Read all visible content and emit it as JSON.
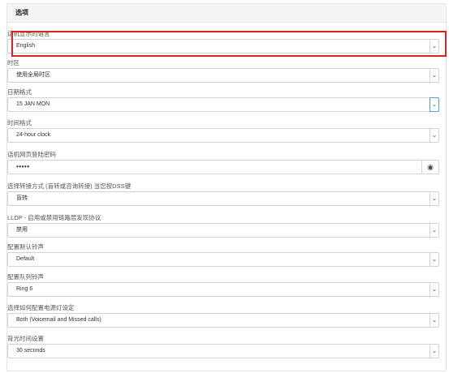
{
  "panel": {
    "title": "选项"
  },
  "fields": [
    {
      "label": "话机显示的语言",
      "value": "English",
      "control": "select"
    },
    {
      "label": "时区",
      "value": "使用全局时区",
      "control": "select"
    },
    {
      "label": "日期格式",
      "value": "15 JAN MON",
      "control": "select"
    },
    {
      "label": "时间格式",
      "value": "24-hour clock",
      "control": "select"
    },
    {
      "label": "话机网页登陆密码",
      "value": "•••••",
      "control": "password"
    },
    {
      "label": "选择转接方式 (盲转或咨询转接) 当您按DSS键",
      "value": "盲转",
      "control": "select"
    },
    {
      "label": "LLDP - 启用或禁用链路层发现协议",
      "value": "禁用",
      "control": "select"
    },
    {
      "label": "配置默认铃声",
      "value": "Default",
      "control": "select"
    },
    {
      "label": "配置队列铃声",
      "value": "Ring 6",
      "control": "select"
    },
    {
      "label": "选择如何配置电源灯设定",
      "value": "Both (Voicemail and Missed calls)",
      "control": "select"
    },
    {
      "label": "背光时间设置",
      "value": "30 seconds",
      "control": "select"
    }
  ],
  "icons": {
    "dropdown": "chevron-down-icon",
    "reveal": "eye-icon"
  },
  "colors": {
    "highlight": "#e02020",
    "active_select": "#5aa0d8"
  }
}
